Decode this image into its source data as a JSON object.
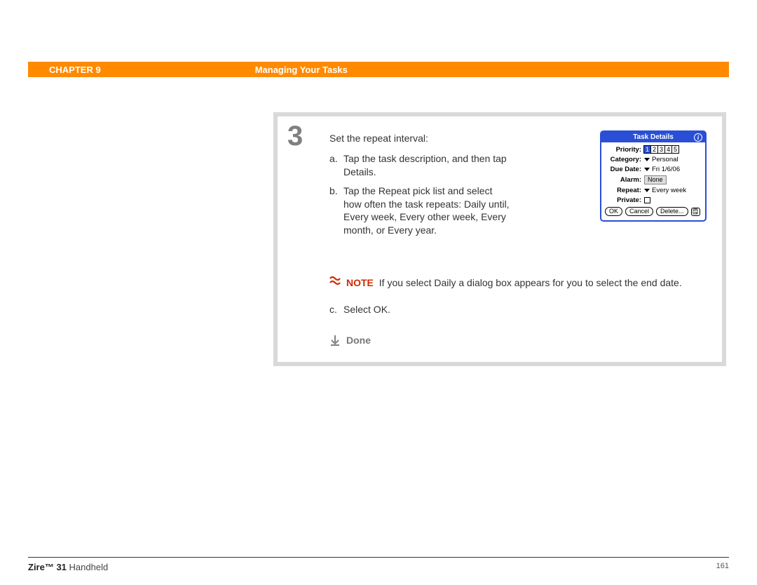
{
  "header": {
    "chapter_label": "CHAPTER 9",
    "chapter_title": "Managing Your Tasks"
  },
  "step": {
    "number": "3",
    "intro": "Set the repeat interval:",
    "a_letter": "a.",
    "a_text": "Tap the task description, and then tap Details.",
    "b_letter": "b.",
    "b_text": "Tap the Repeat pick list and select how often the task repeats: Daily until, Every week, Every other week, Every month, or Every year.",
    "c_letter": "c.",
    "c_text": "Select OK."
  },
  "note": {
    "label": "NOTE",
    "text": "If you select Daily a dialog box appears for you to select the end date."
  },
  "done": "Done",
  "dialog": {
    "title": "Task Details",
    "priority_label": "Priority:",
    "priority_values": [
      "1",
      "2",
      "3",
      "4",
      "5"
    ],
    "category_label": "Category:",
    "category_value": "Personal",
    "due_label": "Due Date:",
    "due_value": "Fri 1/6/06",
    "alarm_label": "Alarm:",
    "alarm_value": "None",
    "repeat_label": "Repeat:",
    "repeat_value": "Every week",
    "private_label": "Private:",
    "ok": "OK",
    "cancel": "Cancel",
    "delete": "Delete...",
    "note_btn": "🗒"
  },
  "footer": {
    "product_bold": "Zire™ 31",
    "product_rest": " Handheld",
    "page": "161"
  }
}
